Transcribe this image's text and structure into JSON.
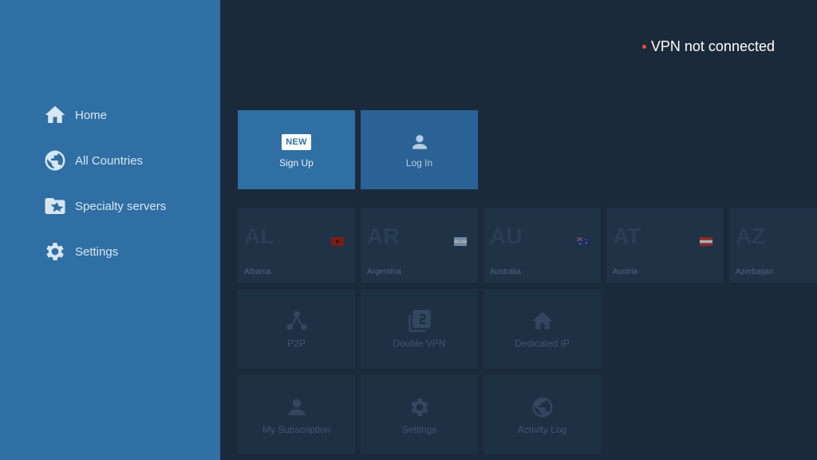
{
  "sidebar": {
    "items": [
      {
        "label": "Home",
        "icon": "home-icon"
      },
      {
        "label": "All Countries",
        "icon": "globe-icon"
      },
      {
        "label": "Specialty servers",
        "icon": "folder-star-icon"
      },
      {
        "label": "Settings",
        "icon": "gear-icon"
      }
    ]
  },
  "status": {
    "text": "VPN not connected",
    "dot_color": "#e84e3c"
  },
  "actions": {
    "signup": {
      "badge": "NEW",
      "label": "Sign Up"
    },
    "login": {
      "label": "Log In",
      "icon": "user-icon"
    }
  },
  "countries": [
    {
      "code": "AL",
      "name": "Albania"
    },
    {
      "code": "AR",
      "name": "Argentina"
    },
    {
      "code": "AU",
      "name": "Australia"
    },
    {
      "code": "AT",
      "name": "Austria"
    },
    {
      "code": "AZ",
      "name": "Azerbaijan"
    }
  ],
  "specialty": [
    {
      "label": "P2P",
      "icon": "p2p-icon"
    },
    {
      "label": "Double VPN",
      "icon": "double-vpn-icon"
    },
    {
      "label": "Dedicated IP",
      "icon": "house-icon"
    }
  ],
  "account": [
    {
      "label": "My Subscription",
      "icon": "user-icon"
    },
    {
      "label": "Settings",
      "icon": "gear-icon"
    },
    {
      "label": "Activity Log",
      "icon": "globe-icon"
    }
  ],
  "colors": {
    "sidebar": "#2f6fa3",
    "background": "#1b2a3b",
    "accent_tile": "#2f6fa3"
  }
}
